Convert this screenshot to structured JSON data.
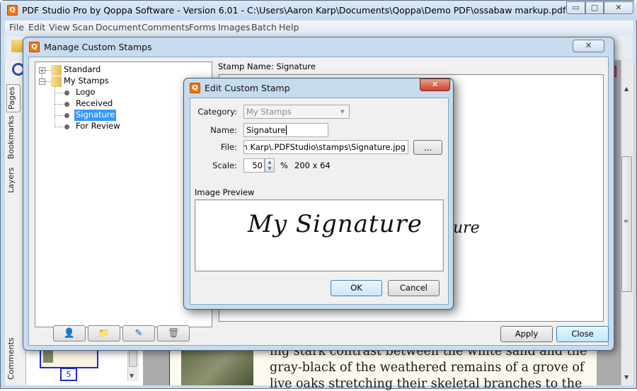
{
  "window": {
    "title": "PDF Studio Pro by Qoppa Software - Version 6.01 - C:\\Users\\Aaron Karp\\Documents\\Qoppa\\Demo PDF\\ossabaw markup.pdf",
    "app_icon_glyph": "Q",
    "minimize_glyph": "▭",
    "maximize_glyph": "▢",
    "close_glyph": "✕"
  },
  "menu": [
    "File",
    "Edit",
    "View",
    "Scan",
    "Document",
    "Comments",
    "Forms",
    "Images",
    "Batch",
    "Help"
  ],
  "side_tabs": {
    "pages": "Pages",
    "bookmarks": "Bookmarks",
    "layers": "Layers",
    "comments": "Comments"
  },
  "thumbnail": {
    "page_number": "5"
  },
  "document": {
    "lines": [
      "ing stark contrast between the white sand and the",
      "gray-black of the weathered remains of a grove of",
      "live oaks stretching their skeletal branches to the"
    ]
  },
  "manage_dialog": {
    "title": "Manage Custom Stamps",
    "icon_glyph": "Q",
    "close_glyph": "✕",
    "tree": {
      "standard": "Standard",
      "my_stamps": "My Stamps",
      "expand_glyph": "+",
      "collapse_glyph": "−",
      "items": [
        "Logo",
        "Received",
        "Signature",
        "For Review"
      ],
      "selected": "Signature"
    },
    "toolbar": {
      "add_stamp_icon": "👤",
      "add_category_icon": "📁",
      "edit_icon": "✎",
      "delete_icon": "🗑"
    },
    "stamp_name_label": "Stamp Name: Signature",
    "preview_fragment": "ure",
    "apply_label": "Apply",
    "close_label": "Close"
  },
  "edit_dialog": {
    "title": "Edit Custom Stamp",
    "icon_glyph": "Q",
    "close_glyph": "✕",
    "category_label": "Category:",
    "category_value": "My Stamps",
    "name_label": "Name:",
    "name_value": "Signature",
    "file_label": "File:",
    "file_value": "s\\Aaron Karp\\.PDFStudio\\stamps\\Signature.jpg",
    "browse_label": "...",
    "scale_label": "Scale:",
    "scale_value": "50",
    "scale_unit": "%",
    "image_dims": "200 x 64",
    "preview_label": "Image Preview",
    "signature_text": "My Signature",
    "ok_label": "OK",
    "cancel_label": "Cancel"
  }
}
